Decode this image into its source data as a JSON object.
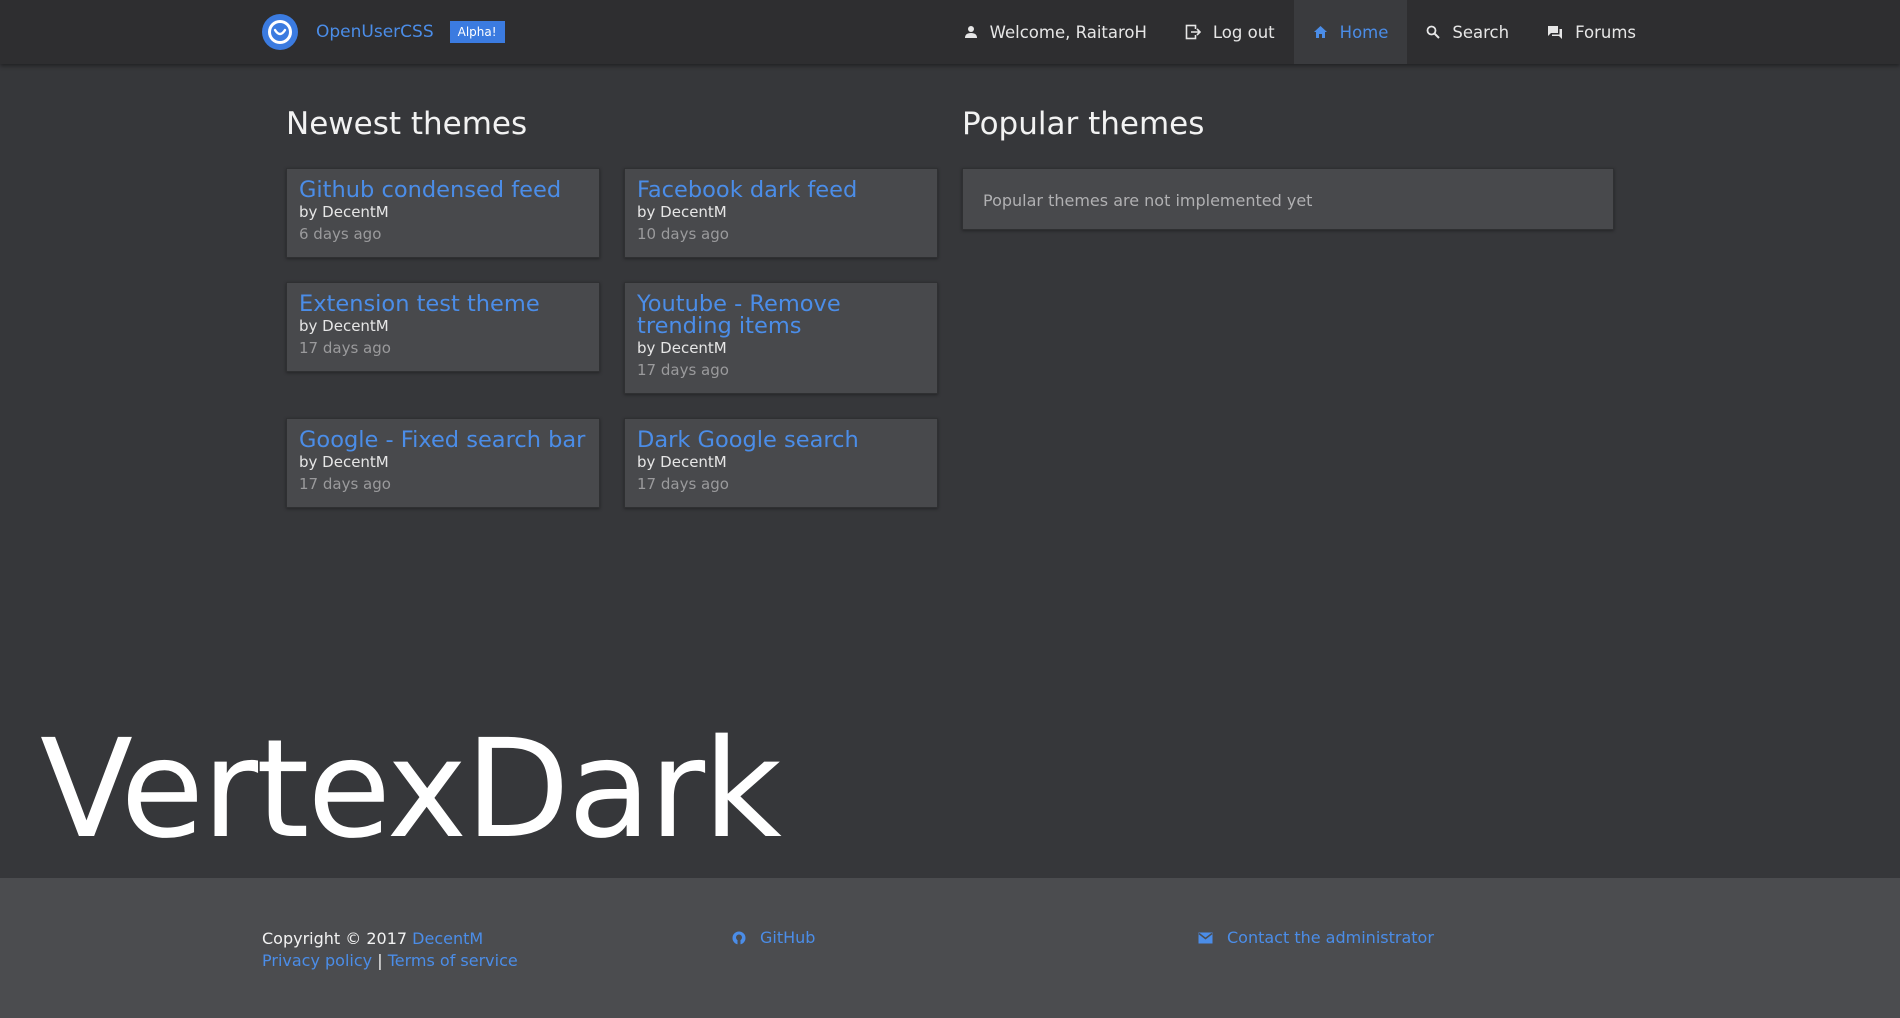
{
  "header": {
    "brand_name": "OpenUserCSS",
    "badge": "Alpha!",
    "nav": [
      {
        "label": "Welcome, RaitaroH",
        "icon": "person-icon"
      },
      {
        "label": "Log out",
        "icon": "logout-icon"
      },
      {
        "label": "Home",
        "icon": "home-icon",
        "active": true
      },
      {
        "label": "Search",
        "icon": "search-icon"
      },
      {
        "label": "Forums",
        "icon": "forum-icon"
      }
    ]
  },
  "newest": {
    "title": "Newest themes",
    "themes": [
      {
        "name": "Github condensed feed",
        "author": "by DecentM",
        "date": "6 days ago"
      },
      {
        "name": "Facebook dark feed",
        "author": "by DecentM",
        "date": "10 days ago"
      },
      {
        "name": "Extension test theme",
        "author": "by DecentM",
        "date": "17 days ago"
      },
      {
        "name": "Youtube - Remove trending items",
        "author": "by DecentM",
        "date": "17 days ago"
      },
      {
        "name": "Google - Fixed search bar",
        "author": "by DecentM",
        "date": "17 days ago"
      },
      {
        "name": "Dark Google search",
        "author": "by DecentM",
        "date": "17 days ago"
      }
    ]
  },
  "popular": {
    "title": "Popular themes",
    "message": "Popular themes are not implemented yet"
  },
  "hero": {
    "text": "VertexDark"
  },
  "footer": {
    "copyright": "Copyright © 2017",
    "author_link": "DecentM",
    "privacy": "Privacy policy",
    "separator": "|",
    "terms": "Terms of service",
    "github": "GitHub",
    "contact": "Contact the administrator"
  },
  "colors": {
    "accent": "#3b7be0",
    "link": "#4b8de8",
    "background": "#36373a",
    "card": "#48494c",
    "navbar": "#2e2e30",
    "footer": "#4b4c4f"
  }
}
